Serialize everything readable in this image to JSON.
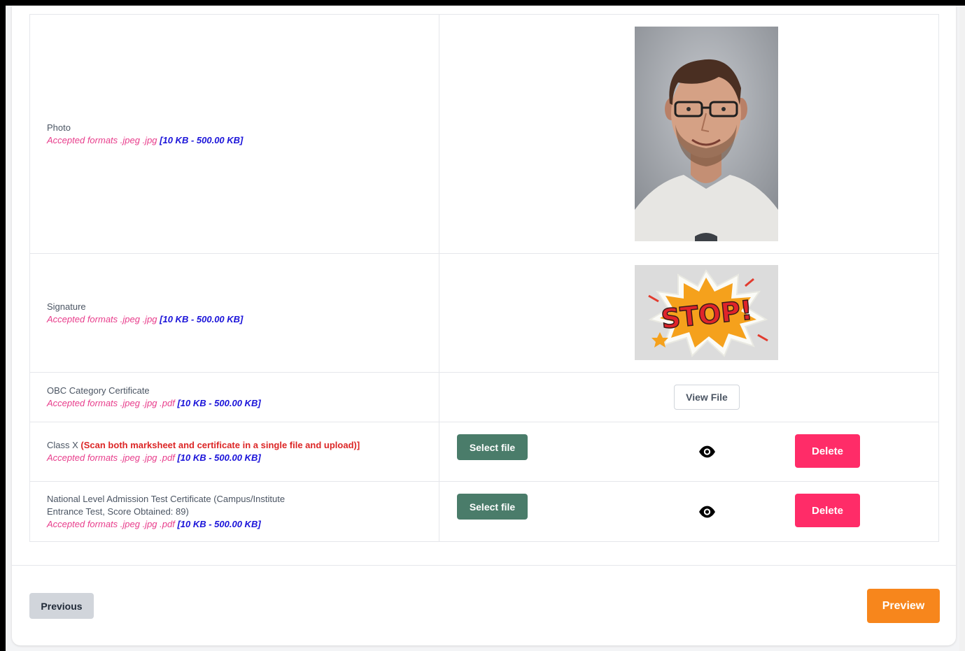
{
  "rows": {
    "photo": {
      "label": "Photo",
      "formats": "Accepted formats .jpeg .jpg",
      "size": "[10 KB - 500.00 KB]"
    },
    "signature": {
      "label": "Signature",
      "formats": "Accepted formats .jpeg .jpg",
      "size": "[10 KB - 500.00 KB]",
      "image_text": "STOP!"
    },
    "obc": {
      "label": "OBC Category Certificate",
      "formats": "Accepted formats .jpeg .jpg .pdf",
      "size": "[10 KB - 500.00 KB]",
      "view_label": "View File"
    },
    "class_x": {
      "label": "Class X",
      "note": "(Scan both marksheet and certificate in a single file and upload)]",
      "formats": "Accepted formats .jpeg .jpg .pdf",
      "size": "[10 KB - 500.00 KB]",
      "select_label": "Select file",
      "delete_label": "Delete"
    },
    "national": {
      "label_line1": "National Level Admission Test Certificate (Campus/Institute",
      "label_line2": "Entrance Test, Score Obtained: 89)",
      "formats": "Accepted formats .jpeg .jpg .pdf",
      "size": "[10 KB - 500.00 KB]",
      "select_label": "Select file",
      "delete_label": "Delete"
    }
  },
  "footer": {
    "previous_label": "Previous",
    "preview_label": "Preview"
  },
  "colors": {
    "select": "#4a7c6a",
    "delete": "#ff2c68",
    "preview": "#f7861c",
    "format_text": "#e83e8c",
    "size_text": "#1a13d9",
    "warning_text": "#dc2626"
  }
}
